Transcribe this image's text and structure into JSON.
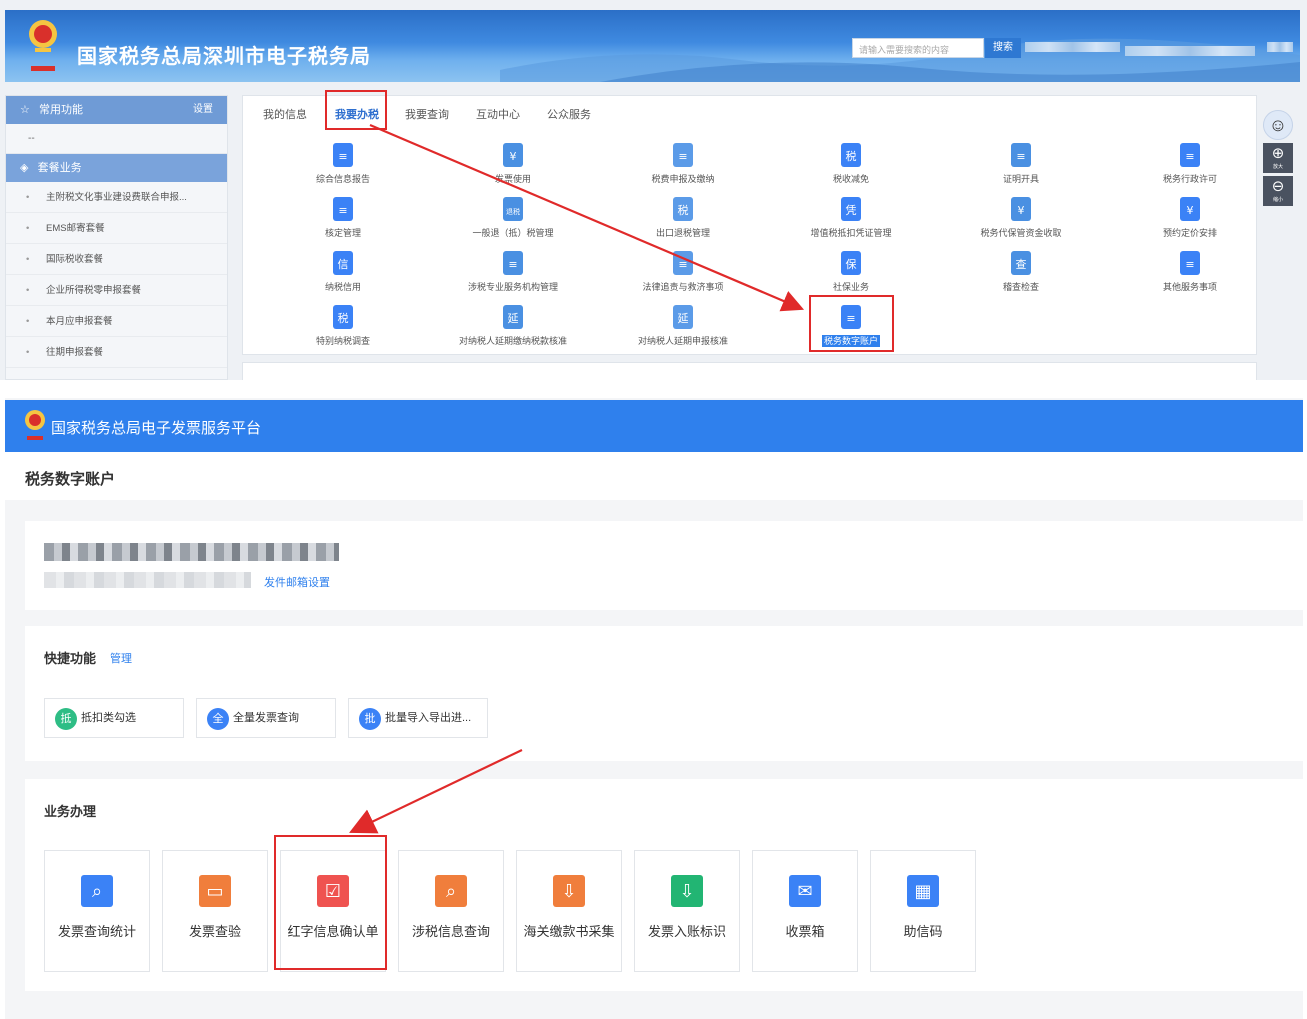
{
  "top": {
    "title": "国家税务总局深圳市电子税务局",
    "search_placeholder": "请输入需要搜索的内容",
    "search_button": "搜索",
    "sidebar": {
      "common_label": "常用功能",
      "settings_label": "设置",
      "dash": "--",
      "package_label": "套餐业务",
      "items": [
        "主附税文化事业建设费联合申报...",
        "EMS邮寄套餐",
        "国际税收套餐",
        "企业所得税零申报套餐",
        "本月应申报套餐",
        "往期申报套餐"
      ]
    },
    "tabs": [
      "我的信息",
      "我要办税",
      "我要查询",
      "互动中心",
      "公众服务"
    ],
    "grid": [
      [
        "综合信息报告",
        "发票使用",
        "税费申报及缴纳",
        "税收减免",
        "证明开具",
        "税务行政许可"
      ],
      [
        "核定管理",
        "一般退（抵）税管理",
        "出口退税管理",
        "增值税抵扣凭证管理",
        "税务代保管资金收取",
        "预约定价安排"
      ],
      [
        "纳税信用",
        "涉税专业服务机构管理",
        "法律追责与救济事项",
        "社保业务",
        "稽查检查",
        "其他服务事项"
      ],
      [
        "特别纳税调查",
        "对纳税人延期缴纳税款核准",
        "对纳税人延期申报核准",
        "税务数字账户"
      ]
    ],
    "icon_glyphs": {
      "grid-0-1": "¥",
      "grid-1-1": "退税",
      "grid-1-2": "税",
      "grid-1-3": "凭",
      "grid-1-4": "¥",
      "grid-1-5": "¥",
      "grid-2-0": "信",
      "grid-2-3": "保",
      "grid-2-4": "查",
      "grid-3-0": "税",
      "grid-3-1": "延",
      "grid-3-2": "延",
      "grid-0-3": "税"
    },
    "float": {
      "zoom_in": "放大",
      "zoom_out": "缩小"
    }
  },
  "bottom": {
    "platform_title": "国家税务总局电子发票服务平台",
    "page_title": "税务数字账户",
    "email_link": "发件邮箱设置",
    "quick_title": "快捷功能",
    "quick_manage": "管理",
    "quick_items": [
      {
        "badge": "抵",
        "label": "抵扣类勾选",
        "color": "#2ebd85"
      },
      {
        "badge": "全",
        "label": "全量发票查询",
        "color": "#3b82f6"
      },
      {
        "badge": "批",
        "label": "批量导入导出进...",
        "color": "#3b82f6"
      }
    ],
    "biz_title": "业务办理",
    "biz_items": [
      {
        "label": "发票查询统计",
        "color": "#3b82f6",
        "icon": "search-doc-icon"
      },
      {
        "label": "发票查验",
        "color": "#f07e3c",
        "icon": "ticket-icon"
      },
      {
        "label": "红字信息确认单",
        "color": "#ef5350",
        "icon": "doc-check-icon"
      },
      {
        "label": "涉税信息查询",
        "color": "#f07e3c",
        "icon": "folder-search-icon"
      },
      {
        "label": "海关缴款书采集",
        "color": "#f07e3c",
        "icon": "doc-download-icon"
      },
      {
        "label": "发票入账标识",
        "color": "#22b573",
        "icon": "inbox-download-icon"
      },
      {
        "label": "收票箱",
        "color": "#3b82f6",
        "icon": "mail-icon"
      },
      {
        "label": "助信码",
        "color": "#3b82f6",
        "icon": "qr-code-icon"
      }
    ]
  },
  "colors": {
    "accent_blue": "#2f80ed",
    "highlight_red": "#e02a2a",
    "top_header": "#3f8ae0"
  }
}
